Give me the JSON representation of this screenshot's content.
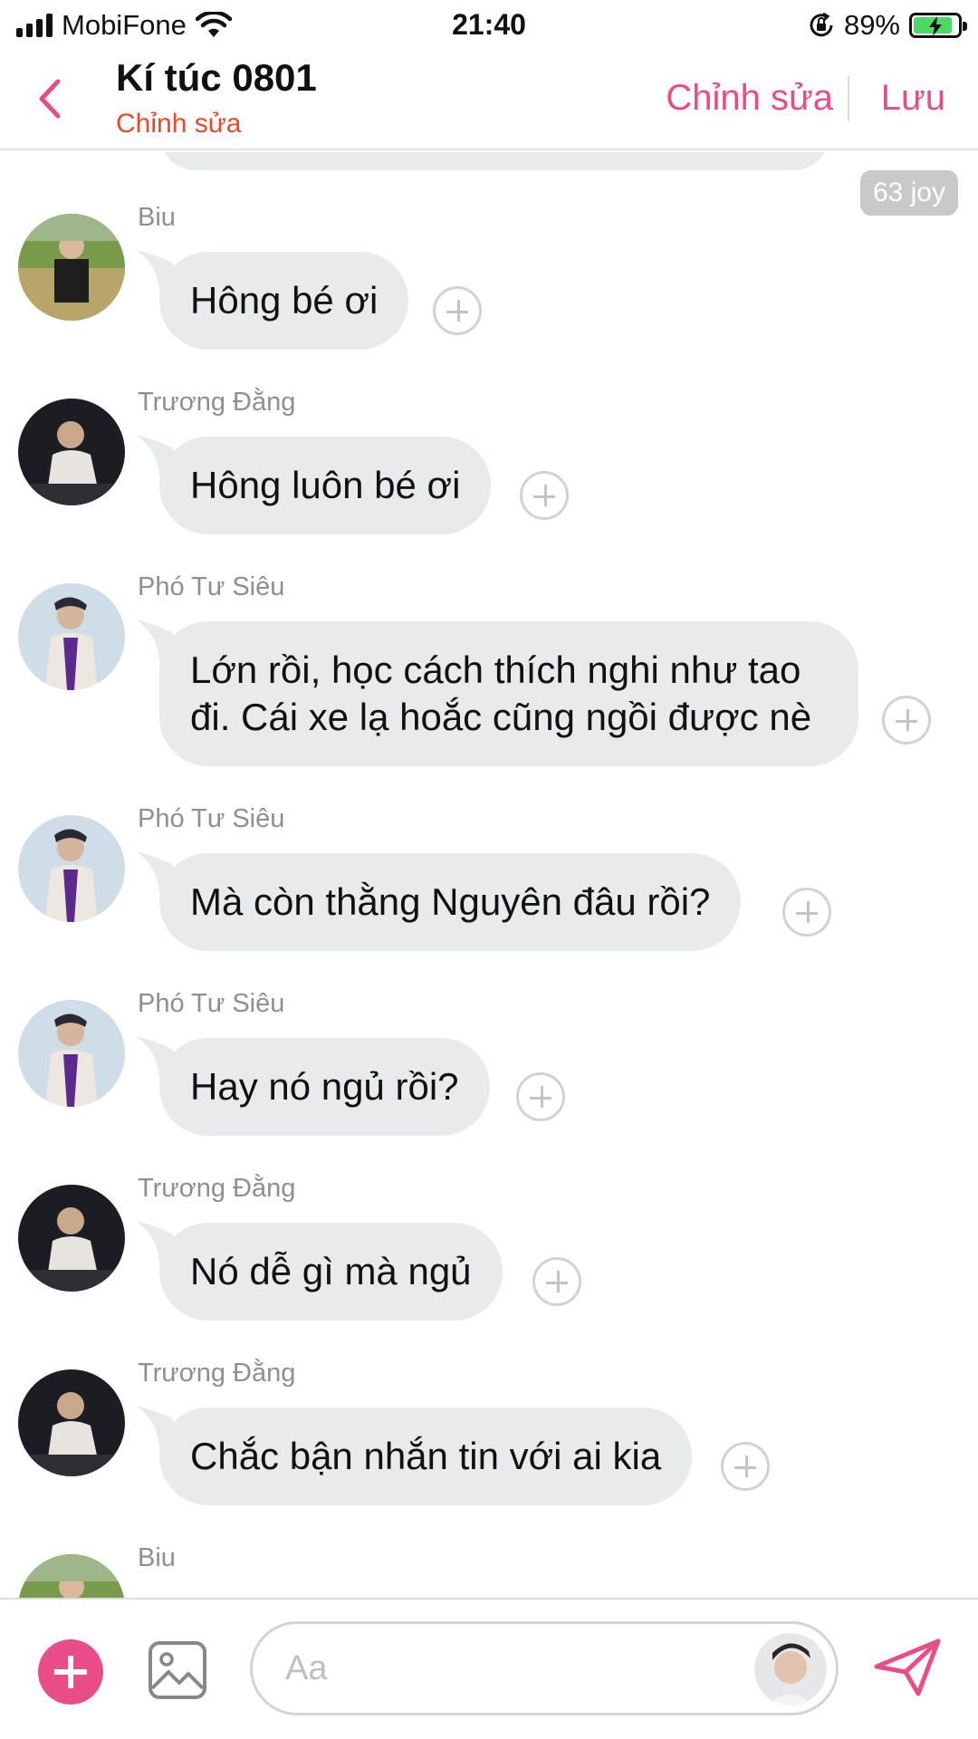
{
  "status_bar": {
    "carrier": "MobiFone",
    "time": "21:40",
    "battery_percent": "89%",
    "icons": [
      "signal-icon",
      "wifi-icon",
      "rotation-lock-icon",
      "battery-charging-icon"
    ]
  },
  "header": {
    "title": "Kí túc 0801",
    "subtitle": "Chỉnh sửa",
    "edit_label": "Chỉnh sửa",
    "save_label": "Lưu",
    "accent_color": "#e84d87",
    "subtitle_color": "#e8492c"
  },
  "reaction_badge": "63 joy",
  "messages": [
    {
      "sender": "Biu",
      "text": "Hông bé ơi"
    },
    {
      "sender": "Trương Đằng",
      "text": "Hông luôn bé ơi"
    },
    {
      "sender": "Phó Tư Siêu",
      "lines": [
        "Lớn rồi, học cách thích nghi như tao",
        "đi. Cái xe lạ hoắc cũng ngồi được nè"
      ]
    },
    {
      "sender": "Phó Tư Siêu",
      "text": "Mà còn thằng Nguyên đâu rồi?"
    },
    {
      "sender": "Phó Tư Siêu",
      "text": "Hay nó ngủ rồi?"
    },
    {
      "sender": "Trương Đằng",
      "text": "Nó dễ gì mà ngủ"
    },
    {
      "sender": "Trương Đằng",
      "text": "Chắc bận nhắn tin với ai kia"
    },
    {
      "sender": "Biu",
      "text": ""
    }
  ],
  "composer": {
    "placeholder": "Aa"
  }
}
